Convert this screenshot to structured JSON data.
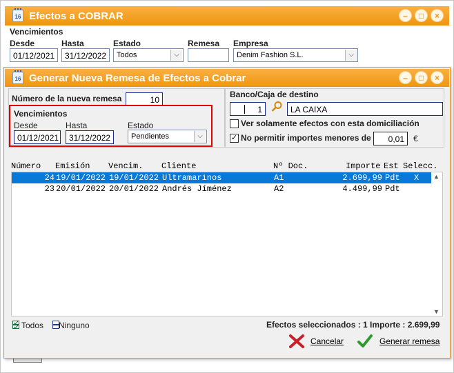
{
  "outer": {
    "title": "Efectos a COBRAR",
    "window_buttons": [
      "minimize-icon",
      "maximize-icon",
      "close-icon"
    ],
    "section": "Vencimientos",
    "desde_label": "Desde",
    "desde_value": "01/12/2021",
    "hasta_label": "Hasta",
    "hasta_value": "31/12/2022",
    "estado_label": "Estado",
    "estado_value": "Todos",
    "remesa_label": "Remesa",
    "remesa_value": "",
    "empresa_label": "Empresa",
    "empresa_value": "Denim Fashion S.L."
  },
  "dialog": {
    "title": "Generar Nueva Remesa de Efectos a Cobrar",
    "numero_label": "Número de la nueva remesa",
    "numero_value": "10",
    "vencimientos": {
      "title": "Vencimientos",
      "desde_label": "Desde",
      "desde_value": "01/12/2021",
      "hasta_label": "Hasta",
      "hasta_value": "31/12/2022",
      "estado_label": "Estado",
      "estado_value": "Pendientes"
    },
    "banco": {
      "label": "Banco/Caja de destino",
      "code": "1",
      "name": "LA CAIXA"
    },
    "check_domiciliacion": {
      "label": "Ver solamente efectos con esta domiciliación",
      "checked": false
    },
    "check_importes": {
      "label": "No permitir importes menores de",
      "checked": true,
      "value": "0,01",
      "unit": "€"
    },
    "table": {
      "headers": [
        "Número",
        "Emisión",
        "Vencim.",
        "Cliente",
        "Nº Doc.",
        "Importe",
        "Est",
        "Selecc."
      ],
      "rows": [
        {
          "numero": "24",
          "emision": "19/01/2022",
          "vencim": "19/01/2022",
          "cliente": "Ultramarinos",
          "doc": "A1",
          "importe": "2.699,99",
          "est": "Pdt",
          "selecc": "X",
          "selected": true
        },
        {
          "numero": "23",
          "emision": "20/01/2022",
          "vencim": "20/01/2022",
          "cliente": "Andrés Jíménez",
          "doc": "A2",
          "importe": "4.499,99",
          "est": "Pdt",
          "selecc": "",
          "selected": false
        }
      ]
    },
    "todos_label": "Todos",
    "ninguno_label": "Ninguno",
    "summary": "Efectos seleccionados : 1 Importe : 2.699,99",
    "cancel_label": "Cancelar",
    "generate_label": "Generar remesa"
  },
  "colors": {
    "accent": "#ef9510",
    "selection": "#0a78d7",
    "highlight_border": "#e00000"
  }
}
